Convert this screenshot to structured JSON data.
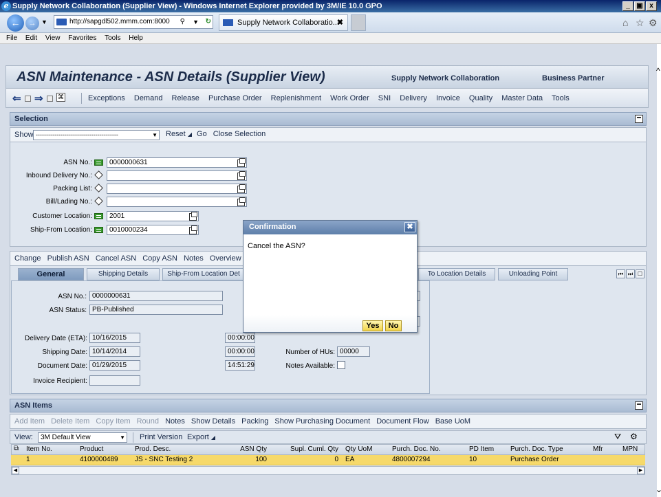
{
  "window": {
    "title": "Supply Network Collaboration (Supplier View) - Windows Internet Explorer provided by 3M/IE 10.0 GPO",
    "min": "_",
    "max": "%",
    "close": "x"
  },
  "browser": {
    "url": "http://sapgdl502.mmm.com:8000",
    "tab_title": "Supply Network Collaboratio...",
    "tab_close": "✖",
    "menus": [
      "File",
      "Edit",
      "View",
      "Favorites",
      "Tools",
      "Help"
    ]
  },
  "header": {
    "title": "ASN Maintenance - ASN Details (Supplier View)",
    "link1": "Supply Network Collaboration",
    "link2": "Business Partner"
  },
  "nav": {
    "items": [
      "Exceptions",
      "Demand",
      "Release",
      "Purchase Order",
      "Replenishment",
      "Work Order",
      "SNI",
      "Delivery",
      "Invoice",
      "Quality",
      "Master Data",
      "Tools"
    ]
  },
  "selection": {
    "title": "Selection",
    "show_label": "Show:",
    "show_value": "----------------------------------------",
    "reset": "Reset",
    "go": "Go",
    "close_selection": "Close Selection",
    "fields": [
      {
        "label": "ASN No.:",
        "value": "0000000631"
      },
      {
        "label": "Inbound Delivery No.:",
        "value": ""
      },
      {
        "label": "Packing List:",
        "value": ""
      },
      {
        "label": "Bill/Lading No.:",
        "value": ""
      },
      {
        "label": "Customer Location:",
        "value": "2001"
      },
      {
        "label": "Ship-From Location:",
        "value": "0010000234"
      }
    ]
  },
  "actions": {
    "items": [
      "Change",
      "Publish ASN",
      "Cancel ASN",
      "Copy ASN",
      "Notes",
      "Overview"
    ]
  },
  "tabs": {
    "general": "General",
    "shipping": "Shipping Details",
    "shipfrom": "Ship-From Location Det",
    "tolocation": "To Location Details",
    "unloading": "Unloading Point"
  },
  "general": {
    "asn_no_label": "ASN No.:",
    "asn_no": "0000000631",
    "asn_status_label": "ASN Status:",
    "asn_status": "PB-Published",
    "delivery_label": "Delivery Date (ETA):",
    "delivery_date": "10/16/2015",
    "delivery_time": "00:00:00",
    "shipping_label": "Shipping Date:",
    "shipping_date": "10/14/2014",
    "shipping_time": "00:00:00",
    "document_label": "Document Date:",
    "document_date": "01/29/2015",
    "document_time": "14:51:29",
    "invoice_label": "Invoice Recipient:",
    "invoice_value": "",
    "hus_label": "Number of HUs:",
    "hus_value": "00000",
    "notes_label": "Notes Available:"
  },
  "items": {
    "title": "ASN Items",
    "toolbar": [
      "Add Item",
      "Delete Item",
      "Copy Item",
      "Round",
      "Notes",
      "Show Details",
      "Packing",
      "Show Purchasing Document",
      "Document Flow",
      "Base UoM"
    ],
    "view_label": "View:",
    "view_value": "3M Default View",
    "print": "Print Version",
    "export": "Export",
    "columns": [
      "Item No.",
      "Product",
      "Prod. Desc.",
      "ASN Qty",
      "Supl. Cuml. Qty",
      "Qty UoM",
      "Purch. Doc. No.",
      "PD Item",
      "Purch. Doc. Type",
      "Mfr",
      "MPN"
    ],
    "rows": [
      [
        "1",
        "4100000489",
        "JS - SNC Testing 2",
        "100",
        "0",
        "EA",
        "4800007294",
        "10",
        "Purchase Order",
        "",
        ""
      ]
    ]
  },
  "dialog": {
    "title": "Confirmation",
    "message": "Cancel the ASN?",
    "yes": "Yes",
    "no": "No",
    "close": "✖"
  }
}
